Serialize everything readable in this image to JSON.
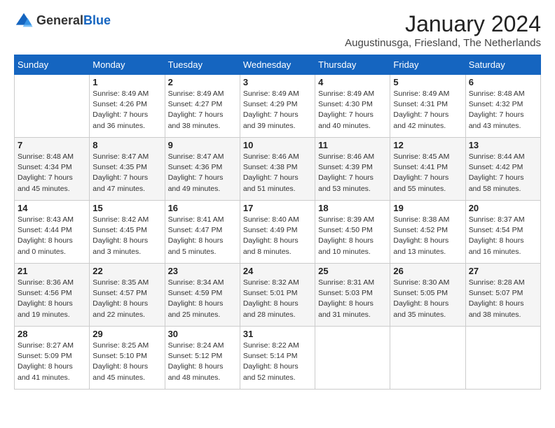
{
  "header": {
    "logo_general": "General",
    "logo_blue": "Blue",
    "month_title": "January 2024",
    "subtitle": "Augustinusga, Friesland, The Netherlands"
  },
  "weekdays": [
    "Sunday",
    "Monday",
    "Tuesday",
    "Wednesday",
    "Thursday",
    "Friday",
    "Saturday"
  ],
  "weeks": [
    [
      {
        "day": "",
        "sunrise": "",
        "sunset": "",
        "daylight": ""
      },
      {
        "day": "1",
        "sunrise": "Sunrise: 8:49 AM",
        "sunset": "Sunset: 4:26 PM",
        "daylight": "Daylight: 7 hours and 36 minutes."
      },
      {
        "day": "2",
        "sunrise": "Sunrise: 8:49 AM",
        "sunset": "Sunset: 4:27 PM",
        "daylight": "Daylight: 7 hours and 38 minutes."
      },
      {
        "day": "3",
        "sunrise": "Sunrise: 8:49 AM",
        "sunset": "Sunset: 4:29 PM",
        "daylight": "Daylight: 7 hours and 39 minutes."
      },
      {
        "day": "4",
        "sunrise": "Sunrise: 8:49 AM",
        "sunset": "Sunset: 4:30 PM",
        "daylight": "Daylight: 7 hours and 40 minutes."
      },
      {
        "day": "5",
        "sunrise": "Sunrise: 8:49 AM",
        "sunset": "Sunset: 4:31 PM",
        "daylight": "Daylight: 7 hours and 42 minutes."
      },
      {
        "day": "6",
        "sunrise": "Sunrise: 8:48 AM",
        "sunset": "Sunset: 4:32 PM",
        "daylight": "Daylight: 7 hours and 43 minutes."
      }
    ],
    [
      {
        "day": "7",
        "sunrise": "Sunrise: 8:48 AM",
        "sunset": "Sunset: 4:34 PM",
        "daylight": "Daylight: 7 hours and 45 minutes."
      },
      {
        "day": "8",
        "sunrise": "Sunrise: 8:47 AM",
        "sunset": "Sunset: 4:35 PM",
        "daylight": "Daylight: 7 hours and 47 minutes."
      },
      {
        "day": "9",
        "sunrise": "Sunrise: 8:47 AM",
        "sunset": "Sunset: 4:36 PM",
        "daylight": "Daylight: 7 hours and 49 minutes."
      },
      {
        "day": "10",
        "sunrise": "Sunrise: 8:46 AM",
        "sunset": "Sunset: 4:38 PM",
        "daylight": "Daylight: 7 hours and 51 minutes."
      },
      {
        "day": "11",
        "sunrise": "Sunrise: 8:46 AM",
        "sunset": "Sunset: 4:39 PM",
        "daylight": "Daylight: 7 hours and 53 minutes."
      },
      {
        "day": "12",
        "sunrise": "Sunrise: 8:45 AM",
        "sunset": "Sunset: 4:41 PM",
        "daylight": "Daylight: 7 hours and 55 minutes."
      },
      {
        "day": "13",
        "sunrise": "Sunrise: 8:44 AM",
        "sunset": "Sunset: 4:42 PM",
        "daylight": "Daylight: 7 hours and 58 minutes."
      }
    ],
    [
      {
        "day": "14",
        "sunrise": "Sunrise: 8:43 AM",
        "sunset": "Sunset: 4:44 PM",
        "daylight": "Daylight: 8 hours and 0 minutes."
      },
      {
        "day": "15",
        "sunrise": "Sunrise: 8:42 AM",
        "sunset": "Sunset: 4:45 PM",
        "daylight": "Daylight: 8 hours and 3 minutes."
      },
      {
        "day": "16",
        "sunrise": "Sunrise: 8:41 AM",
        "sunset": "Sunset: 4:47 PM",
        "daylight": "Daylight: 8 hours and 5 minutes."
      },
      {
        "day": "17",
        "sunrise": "Sunrise: 8:40 AM",
        "sunset": "Sunset: 4:49 PM",
        "daylight": "Daylight: 8 hours and 8 minutes."
      },
      {
        "day": "18",
        "sunrise": "Sunrise: 8:39 AM",
        "sunset": "Sunset: 4:50 PM",
        "daylight": "Daylight: 8 hours and 10 minutes."
      },
      {
        "day": "19",
        "sunrise": "Sunrise: 8:38 AM",
        "sunset": "Sunset: 4:52 PM",
        "daylight": "Daylight: 8 hours and 13 minutes."
      },
      {
        "day": "20",
        "sunrise": "Sunrise: 8:37 AM",
        "sunset": "Sunset: 4:54 PM",
        "daylight": "Daylight: 8 hours and 16 minutes."
      }
    ],
    [
      {
        "day": "21",
        "sunrise": "Sunrise: 8:36 AM",
        "sunset": "Sunset: 4:56 PM",
        "daylight": "Daylight: 8 hours and 19 minutes."
      },
      {
        "day": "22",
        "sunrise": "Sunrise: 8:35 AM",
        "sunset": "Sunset: 4:57 PM",
        "daylight": "Daylight: 8 hours and 22 minutes."
      },
      {
        "day": "23",
        "sunrise": "Sunrise: 8:34 AM",
        "sunset": "Sunset: 4:59 PM",
        "daylight": "Daylight: 8 hours and 25 minutes."
      },
      {
        "day": "24",
        "sunrise": "Sunrise: 8:32 AM",
        "sunset": "Sunset: 5:01 PM",
        "daylight": "Daylight: 8 hours and 28 minutes."
      },
      {
        "day": "25",
        "sunrise": "Sunrise: 8:31 AM",
        "sunset": "Sunset: 5:03 PM",
        "daylight": "Daylight: 8 hours and 31 minutes."
      },
      {
        "day": "26",
        "sunrise": "Sunrise: 8:30 AM",
        "sunset": "Sunset: 5:05 PM",
        "daylight": "Daylight: 8 hours and 35 minutes."
      },
      {
        "day": "27",
        "sunrise": "Sunrise: 8:28 AM",
        "sunset": "Sunset: 5:07 PM",
        "daylight": "Daylight: 8 hours and 38 minutes."
      }
    ],
    [
      {
        "day": "28",
        "sunrise": "Sunrise: 8:27 AM",
        "sunset": "Sunset: 5:09 PM",
        "daylight": "Daylight: 8 hours and 41 minutes."
      },
      {
        "day": "29",
        "sunrise": "Sunrise: 8:25 AM",
        "sunset": "Sunset: 5:10 PM",
        "daylight": "Daylight: 8 hours and 45 minutes."
      },
      {
        "day": "30",
        "sunrise": "Sunrise: 8:24 AM",
        "sunset": "Sunset: 5:12 PM",
        "daylight": "Daylight: 8 hours and 48 minutes."
      },
      {
        "day": "31",
        "sunrise": "Sunrise: 8:22 AM",
        "sunset": "Sunset: 5:14 PM",
        "daylight": "Daylight: 8 hours and 52 minutes."
      },
      {
        "day": "",
        "sunrise": "",
        "sunset": "",
        "daylight": ""
      },
      {
        "day": "",
        "sunrise": "",
        "sunset": "",
        "daylight": ""
      },
      {
        "day": "",
        "sunrise": "",
        "sunset": "",
        "daylight": ""
      }
    ]
  ]
}
